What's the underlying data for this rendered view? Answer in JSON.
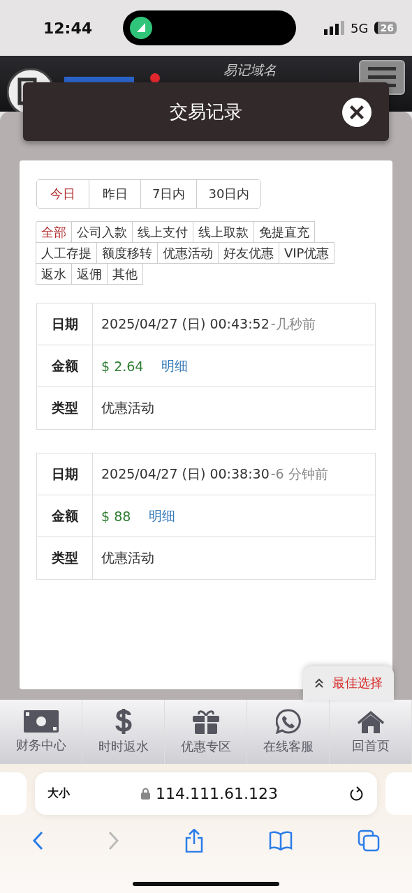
{
  "status_bar": {
    "time": "12:44",
    "network": "5G",
    "battery": "26"
  },
  "site_header": {
    "slogan": "易记域名"
  },
  "modal": {
    "title": "交易记录"
  },
  "date_tabs": [
    {
      "label": "今日",
      "selected": true
    },
    {
      "label": "昨日",
      "selected": false
    },
    {
      "label": "7日内",
      "selected": false
    },
    {
      "label": "30日内",
      "selected": false
    }
  ],
  "type_filters": [
    [
      {
        "label": "全部",
        "selected": true
      },
      {
        "label": "公司入款",
        "selected": false
      },
      {
        "label": "线上支付",
        "selected": false
      },
      {
        "label": "线上取款",
        "selected": false
      },
      {
        "label": "免提直充",
        "selected": false
      }
    ],
    [
      {
        "label": "人工存提",
        "selected": false
      },
      {
        "label": "额度移转",
        "selected": false
      },
      {
        "label": "优惠活动",
        "selected": false
      },
      {
        "label": "好友优惠",
        "selected": false
      },
      {
        "label": "VIP优惠",
        "selected": false
      }
    ],
    [
      {
        "label": "返水",
        "selected": false
      },
      {
        "label": "返佣",
        "selected": false
      },
      {
        "label": "其他",
        "selected": false
      }
    ]
  ],
  "records": [
    {
      "date_label": "日期",
      "date": "2025/04/27 (日) 00:43:52",
      "ago": "-几秒前",
      "amount_label": "金额",
      "amount": "$ 2.64",
      "detail": "明细",
      "type_label": "类型",
      "type": "优惠活动"
    },
    {
      "date_label": "日期",
      "date": "2025/04/27 (日) 00:38:30",
      "ago": "-6 分钟前",
      "amount_label": "金额",
      "amount": "$ 88",
      "detail": "明细",
      "type_label": "类型",
      "type": "优惠活动"
    }
  ],
  "float_button": "最佳选择",
  "bottom_nav": [
    {
      "kind": "money",
      "label": "财务中心"
    },
    {
      "kind": "dollar",
      "label": "时时返水"
    },
    {
      "kind": "gift",
      "label": "优惠专区"
    },
    {
      "kind": "chat",
      "label": "在线客服"
    },
    {
      "kind": "home",
      "label": "回首页"
    }
  ],
  "browser": {
    "text_size": "大小",
    "url": "114.111.61.123"
  }
}
